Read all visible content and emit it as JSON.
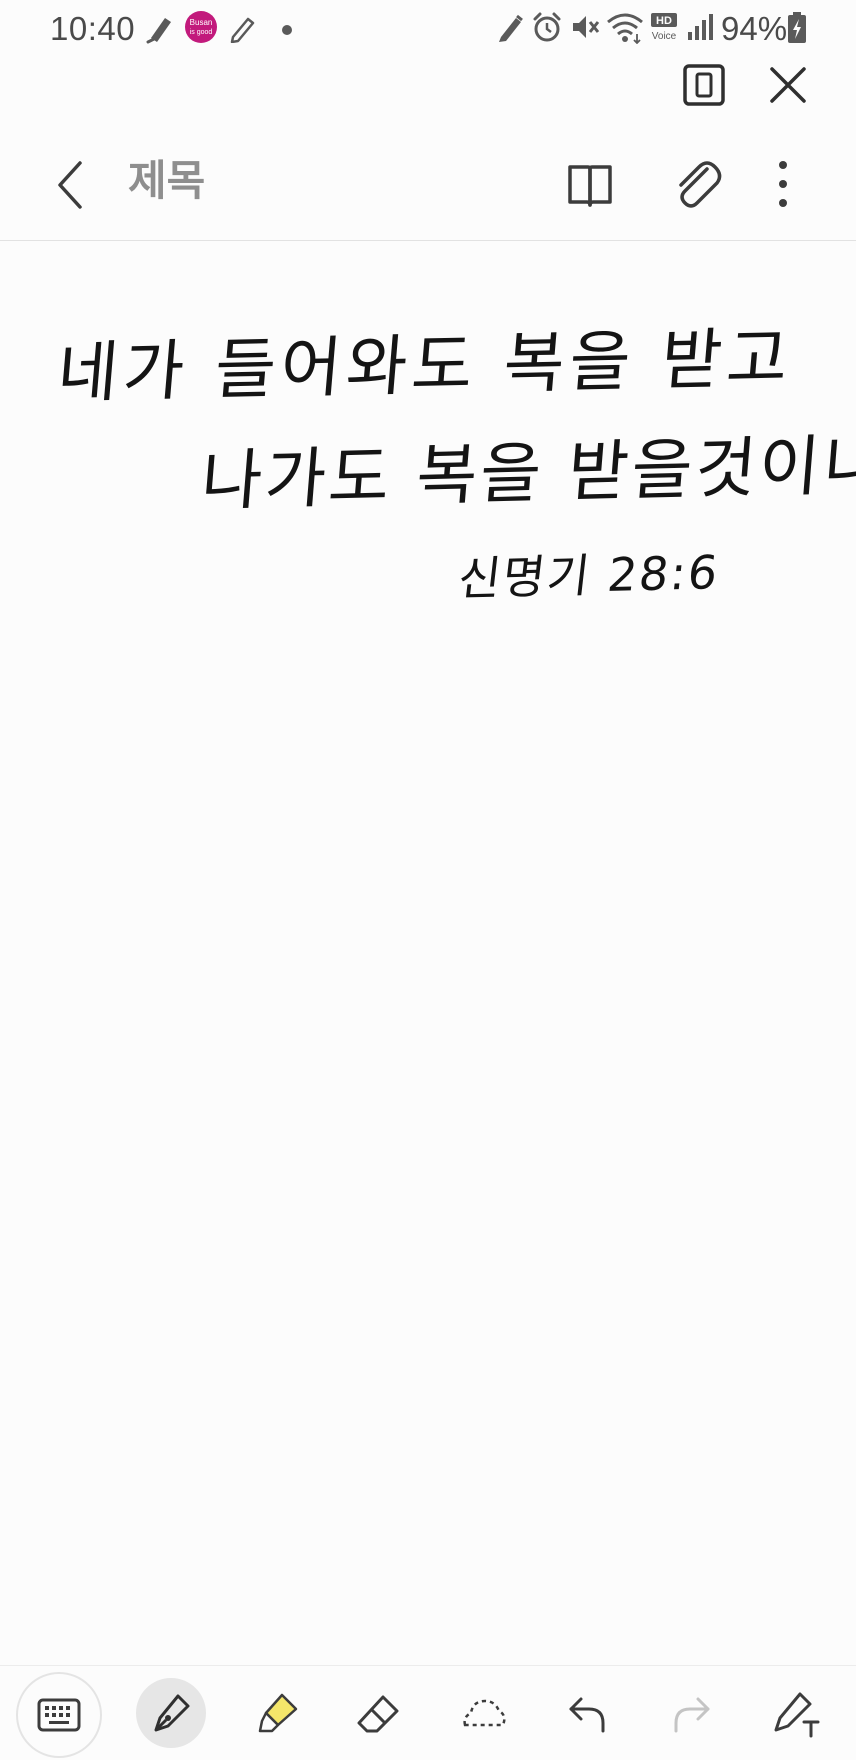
{
  "status_bar": {
    "time": "10:40",
    "battery": "94%",
    "hd_label": "HD",
    "voice_label": "Voice",
    "app_badge_text_top": "Busan",
    "app_badge_text_bottom": "is good"
  },
  "window": {
    "popup_icon": "popup-view-icon",
    "close_icon": "close-icon"
  },
  "header": {
    "back_icon": "chevron-left-icon",
    "title_placeholder": "제목",
    "title_value": "",
    "reading_mode_icon": "book-icon",
    "attach_icon": "paperclip-icon",
    "more_icon": "more-vertical-icon"
  },
  "handwriting": {
    "line_1": "네가 들어와도 복을 받고",
    "line_2": "나가도 복을 받을것이니라",
    "line_3": "신명기 28:6"
  },
  "pen_toolbar": {
    "tools": [
      {
        "name": "keyboard",
        "icon": "keyboard-icon"
      },
      {
        "name": "pen",
        "icon": "fountain-pen-icon",
        "selected": true
      },
      {
        "name": "highlighter",
        "icon": "highlighter-icon",
        "color": "#f4e66a"
      },
      {
        "name": "eraser",
        "icon": "eraser-icon"
      },
      {
        "name": "lasso",
        "icon": "lasso-select-icon"
      },
      {
        "name": "undo",
        "icon": "undo-icon"
      },
      {
        "name": "redo",
        "icon": "redo-icon",
        "disabled": true
      },
      {
        "name": "pen-to-text",
        "icon": "pen-to-text-icon"
      }
    ]
  },
  "colors": {
    "background": "#fcfcfc",
    "ink": "#141414",
    "icon": "#3c3c3c",
    "title_placeholder": "#8e8e8e",
    "disabled_icon": "#c4c4c4",
    "badge_magenta": "#c21a7c"
  }
}
